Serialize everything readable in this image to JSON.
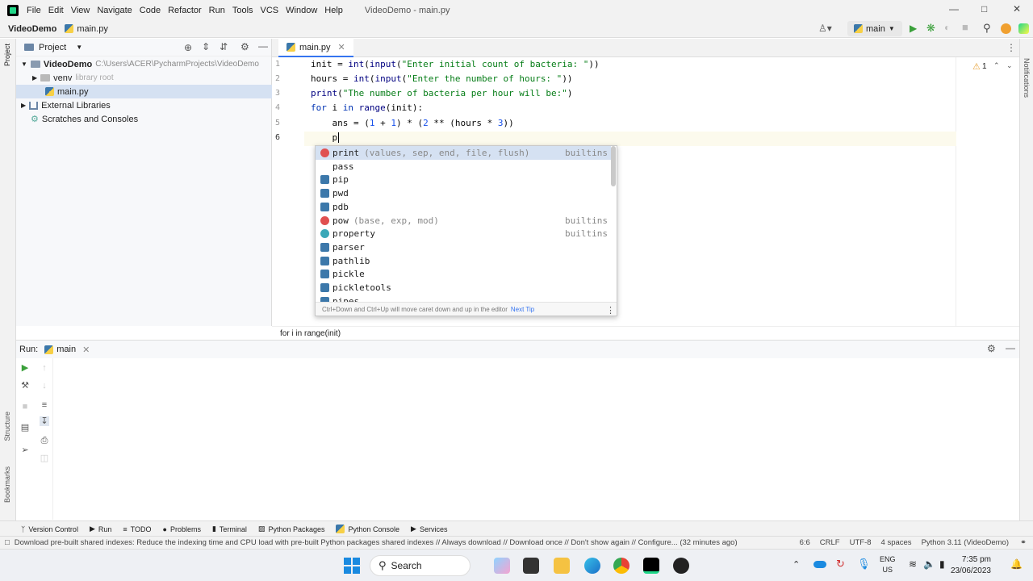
{
  "menu": [
    "File",
    "Edit",
    "View",
    "Navigate",
    "Code",
    "Refactor",
    "Run",
    "Tools",
    "VCS",
    "Window",
    "Help"
  ],
  "window_title": "VideoDemo - main.py",
  "nav": {
    "project": "VideoDemo",
    "file": "main.py"
  },
  "run_config": "main",
  "project_panel": {
    "title": "Project",
    "tree": {
      "root": "VideoDemo",
      "root_path": "C:\\Users\\ACER\\PycharmProjects\\VideoDemo",
      "venv": "venv",
      "venv_note": "library root",
      "main": "main.py",
      "ext": "External Libraries",
      "scratch": "Scratches and Consoles"
    }
  },
  "editor": {
    "tab": "main.py",
    "line_numbers": [
      "1",
      "2",
      "3",
      "4",
      "5",
      "6"
    ],
    "lines": {
      "l1a": "init",
      "l1b": " = ",
      "l1c": "int",
      "l1d": "(",
      "l1e": "input",
      "l1f": "(",
      "l1g": "\"Enter initial count of bacteria: \"",
      "l1h": "))",
      "l2a": "hours",
      "l2b": " = ",
      "l2c": "int",
      "l2d": "(",
      "l2e": "input",
      "l2f": "(",
      "l2g": "\"Enter the number of hours: \"",
      "l2h": "))",
      "l3a": "print",
      "l3b": "(",
      "l3c": "\"The number of bacteria per hour will be:\"",
      "l3d": ")",
      "l4a": "for",
      "l4b": " i ",
      "l4c": "in",
      "l4d": " ",
      "l4e": "range",
      "l4f": "(init):",
      "l5a": "    ans = (",
      "l5b": "1",
      "l5c": " + ",
      "l5d": "1",
      "l5e": ") * (",
      "l5f": "2",
      "l5g": " ** (hours * ",
      "l5h": "3",
      "l5i": "))",
      "l6": "    p"
    },
    "inspections": "1",
    "breadcrumb": "for i in range(init)"
  },
  "completion": {
    "items": [
      {
        "name": "print",
        "tail": "(values, sep, end, file, flush)",
        "source": "builtins",
        "icon_color": "#e05050"
      },
      {
        "name": "pass",
        "tail": "",
        "source": "",
        "icon_color": ""
      },
      {
        "name": "pip",
        "tail": "",
        "source": "",
        "icon_color": "#3c78aa"
      },
      {
        "name": "pwd",
        "tail": "",
        "source": "",
        "icon_color": "#3c78aa"
      },
      {
        "name": "pdb",
        "tail": "",
        "source": "",
        "icon_color": "#3c78aa"
      },
      {
        "name": "pow",
        "tail": "(base, exp, mod)",
        "source": "builtins",
        "icon_color": "#e05050"
      },
      {
        "name": "property",
        "tail": "",
        "source": "builtins",
        "icon_color": "#3aa8b8"
      },
      {
        "name": "parser",
        "tail": "",
        "source": "",
        "icon_color": "#3c78aa"
      },
      {
        "name": "pathlib",
        "tail": "",
        "source": "",
        "icon_color": "#3c78aa"
      },
      {
        "name": "pickle",
        "tail": "",
        "source": "",
        "icon_color": "#3c78aa"
      },
      {
        "name": "pickletools",
        "tail": "",
        "source": "",
        "icon_color": "#3c78aa"
      },
      {
        "name": "pipes",
        "tail": "",
        "source": "",
        "icon_color": "#3c78aa"
      }
    ],
    "footer": "Ctrl+Down and Ctrl+Up will move caret down and up in the editor",
    "next_tip": "Next Tip"
  },
  "run_panel": {
    "label": "Run:",
    "tab": "main"
  },
  "tool_windows": [
    "Version Control",
    "Run",
    "TODO",
    "Problems",
    "Terminal",
    "Python Packages",
    "Python Console",
    "Services"
  ],
  "side_labels": {
    "project": "Project",
    "structure": "Structure",
    "bookmarks": "Bookmarks",
    "notifications": "Notifications"
  },
  "status": {
    "message": "Download pre-built shared indexes: Reduce the indexing time and CPU load with pre-built Python packages shared indexes // Always download // Download once // Don't show again // Configure... (32 minutes ago)",
    "position": "6:6",
    "line_sep": "CRLF",
    "encoding": "UTF-8",
    "indent": "4 spaces",
    "interpreter": "Python 3.11 (VideoDemo)"
  },
  "taskbar": {
    "search": "Search",
    "lang": "ENG",
    "region": "US",
    "time": "7:35 pm",
    "date": "23/06/2023"
  }
}
